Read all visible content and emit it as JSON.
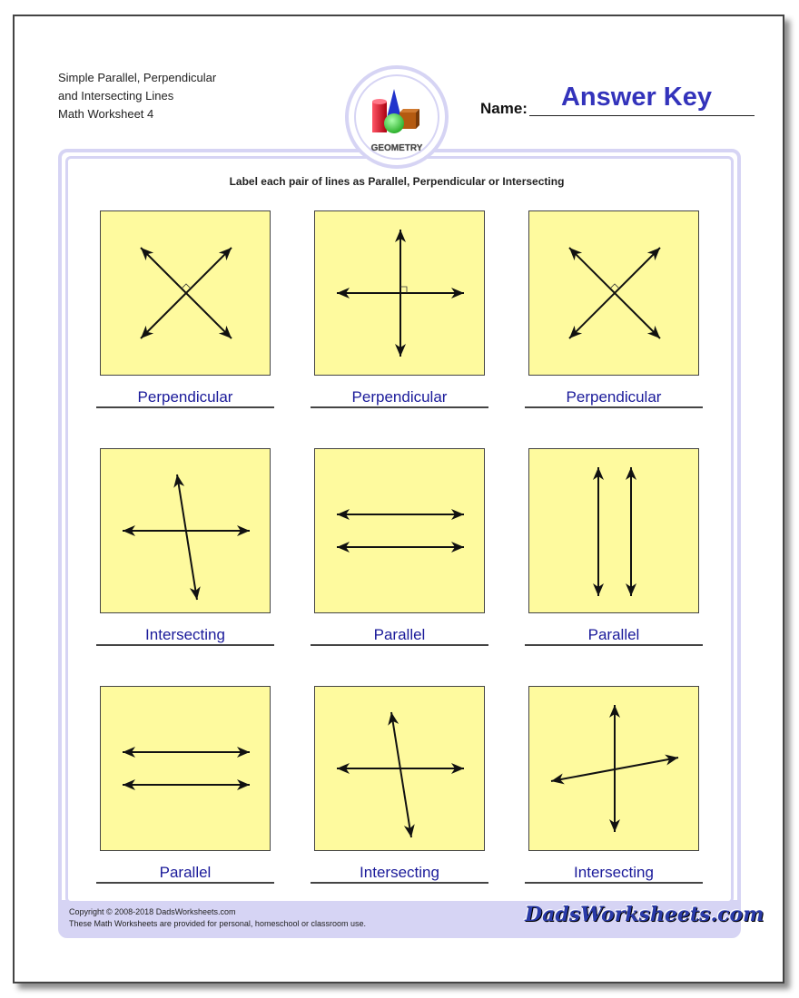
{
  "header": {
    "title_lines": [
      "Simple Parallel, Perpendicular",
      "and Intersecting Lines",
      "Math Worksheet 4"
    ],
    "name_label": "Name:",
    "name_value": "Answer Key",
    "logo_text": "GEOMETRY"
  },
  "instructions": "Label each pair of lines as Parallel, Perpendicular or Intersecting",
  "colors": {
    "box_fill": "#fefa9e",
    "answer_text": "#1a1a9a",
    "frame": "#d6d4f4",
    "answer_key": "#3333bb"
  },
  "problems": [
    {
      "figure": "x-perpendicular",
      "answer": "Perpendicular"
    },
    {
      "figure": "plus-perpendicular",
      "answer": "Perpendicular"
    },
    {
      "figure": "x-perpendicular",
      "answer": "Perpendicular"
    },
    {
      "figure": "tilted-intersecting",
      "answer": "Intersecting"
    },
    {
      "figure": "horizontal-parallel",
      "answer": "Parallel"
    },
    {
      "figure": "vertical-parallel",
      "answer": "Parallel"
    },
    {
      "figure": "horizontal-parallel",
      "answer": "Parallel"
    },
    {
      "figure": "tilted-intersecting",
      "answer": "Intersecting"
    },
    {
      "figure": "vertical-sloped-intersecting",
      "answer": "Intersecting"
    }
  ],
  "footer": {
    "copyright": "Copyright © 2008-2018 DadsWorksheets.com",
    "usage": "These Math Worksheets are provided for personal, homeschool or classroom use.",
    "brand": "DadsWorksheets.com"
  }
}
